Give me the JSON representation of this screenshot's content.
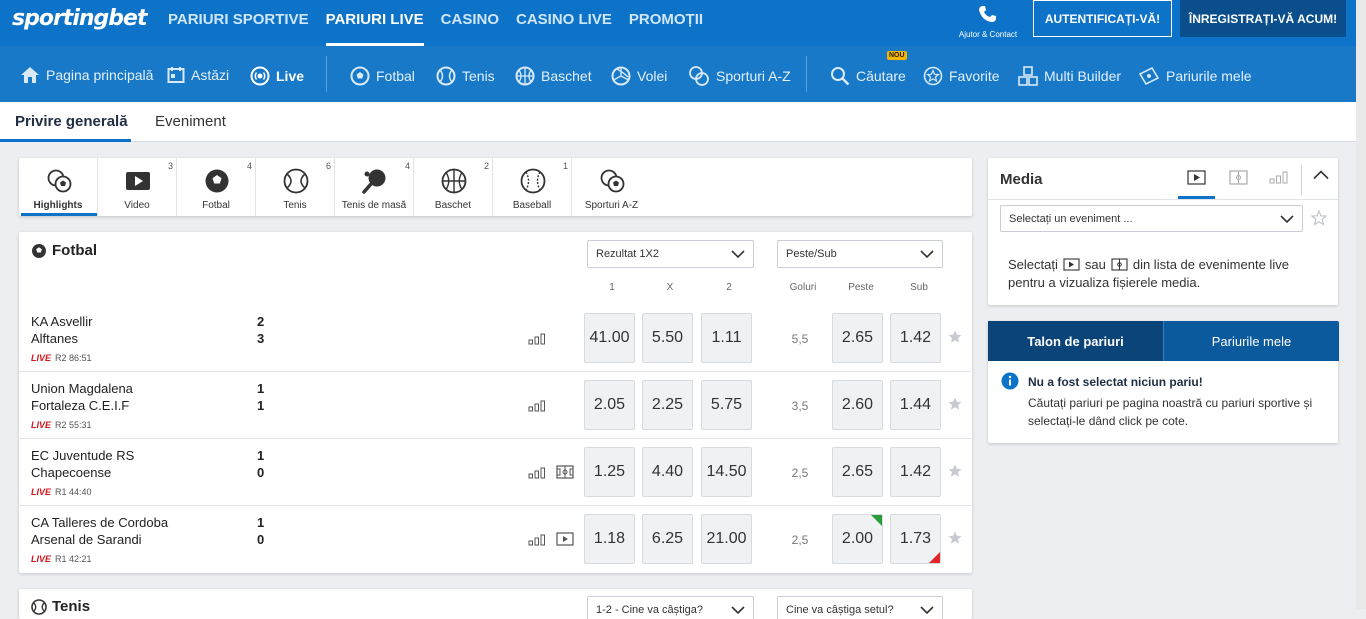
{
  "brand": {
    "logo_text": "sportingbet",
    "primary": "#0d73c9",
    "live_red": "#d4161c"
  },
  "topnav": [
    "PARIURI SPORTIVE",
    "PARIURI LIVE",
    "CASINO",
    "CASINO LIVE",
    "PROMOȚII"
  ],
  "header": {
    "help_label": "Ajutor & Contact",
    "login_label": "AUTENTIFICAȚI-VĂ!",
    "register_label": "ÎNREGISTRAȚI-VĂ ACUM!"
  },
  "subnav": {
    "home": "Pagina principală",
    "today": "Astăzi",
    "live": "Live",
    "football": "Fotbal",
    "tennis": "Tenis",
    "basketball": "Baschet",
    "volleyball": "Volei",
    "sports_az": "Sporturi A-Z",
    "search": "Căutare",
    "new_badge": "NOU",
    "favorites": "Favorite",
    "multi_builder": "Multi Builder",
    "my_bets": "Pariurile mele"
  },
  "page_tabs": [
    "Privire generală",
    "Eveniment"
  ],
  "sport_filters": [
    {
      "name": "Highlights",
      "count": "",
      "icon": "sports-balls-icon"
    },
    {
      "name": "Video",
      "count": "3",
      "icon": "video-icon"
    },
    {
      "name": "Fotbal",
      "count": "4",
      "icon": "soccer-ball-icon"
    },
    {
      "name": "Tenis",
      "count": "6",
      "icon": "tennis-ball-icon"
    },
    {
      "name": "Tenis de masă",
      "count": "4",
      "icon": "ping-pong-icon"
    },
    {
      "name": "Baschet",
      "count": "2",
      "icon": "basketball-icon"
    },
    {
      "name": "Baseball",
      "count": "1",
      "icon": "baseball-icon"
    },
    {
      "name": "Sporturi A-Z",
      "count": "",
      "icon": "sports-balls-icon"
    }
  ],
  "football": {
    "title": "Fotbal",
    "market1": "Rezultat 1X2",
    "market2": "Peste/Sub",
    "columns": [
      "1",
      "X",
      "2",
      "Goluri",
      "Peste",
      "Sub"
    ],
    "live_label": "LIVE",
    "matches": [
      {
        "home": "KA Asvellir",
        "away": "Alftanes",
        "score_home": "2",
        "score_away": "3",
        "period": "R2 86:51",
        "odds": [
          "41.00",
          "5.50",
          "1.11"
        ],
        "goals_line": "5,5",
        "over": "2.65",
        "under": "1.42",
        "extra": ""
      },
      {
        "home": "Union Magdalena",
        "away": "Fortaleza C.E.I.F",
        "score_home": "1",
        "score_away": "1",
        "period": "R2 55:31",
        "odds": [
          "2.05",
          "2.25",
          "5.75"
        ],
        "goals_line": "3,5",
        "over": "2.60",
        "under": "1.44",
        "extra": ""
      },
      {
        "home": "EC Juventude RS",
        "away": "Chapecoense",
        "score_home": "1",
        "score_away": "0",
        "period": "R1 44:40",
        "odds": [
          "1.25",
          "4.40",
          "14.50"
        ],
        "goals_line": "2,5",
        "over": "2.65",
        "under": "1.42",
        "extra": "field-icon"
      },
      {
        "home": "CA Talleres de Cordoba",
        "away": "Arsenal de Sarandi",
        "score_home": "1",
        "score_away": "0",
        "period": "R1 42:21",
        "odds": [
          "1.18",
          "6.25",
          "21.00"
        ],
        "goals_line": "2,5",
        "over": "2.00",
        "under": "1.73",
        "extra": "play-icon"
      }
    ]
  },
  "tennis": {
    "title": "Tenis",
    "market1": "1-2 - Cine va câștiga?",
    "market2": "Cine va câștiga setul?"
  },
  "media": {
    "title": "Media",
    "select_placeholder": "Selectați un eveniment ...",
    "hint_a": "Selectați",
    "hint_b": "sau",
    "hint_c": "din lista de evenimente live",
    "hint_d": "pentru a vizualiza fișierele media."
  },
  "betslip": {
    "tab1": "Talon de pariuri",
    "tab2": "Pariurile mele",
    "empty_title": "Nu a fost selectat niciun pariu!",
    "empty_text": "Căutați pariuri pe pagina noastră cu pariuri sportive și selectați-le dând click pe cote."
  }
}
